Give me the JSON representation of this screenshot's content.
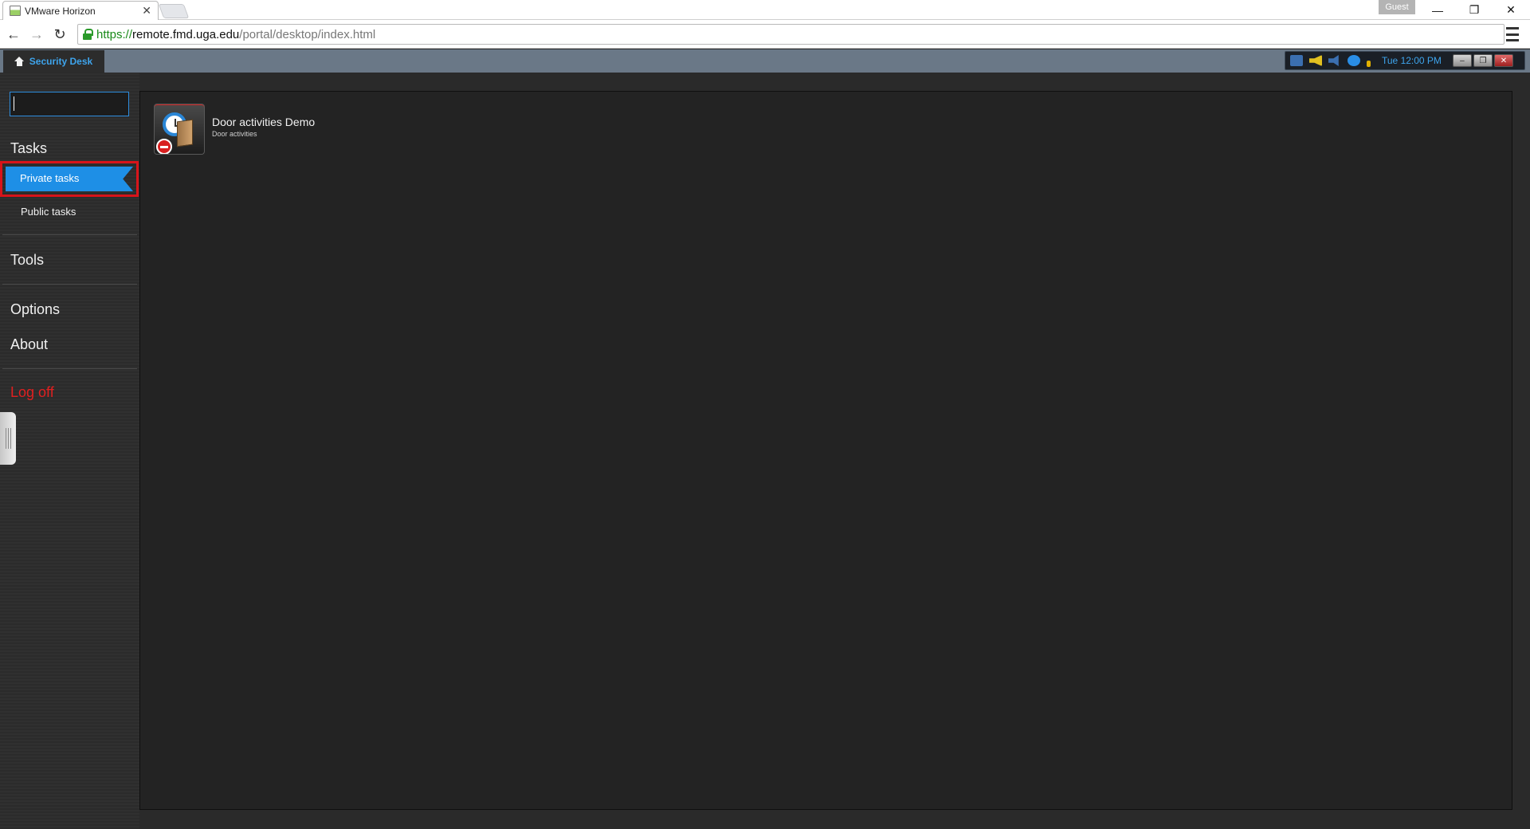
{
  "browser": {
    "tab_title": "VMware Horizon",
    "tab_close": "✕",
    "guest_label": "Guest",
    "minimize": "—",
    "restore": "❐",
    "close": "✕",
    "back": "←",
    "forward": "→",
    "reload": "↻",
    "url_scheme": "https://",
    "url_host": "remote.fmd.uga.edu",
    "url_path": "/portal/desktop/index.html"
  },
  "app_header": {
    "home_tab_label": "Security Desk",
    "tray_time": "Tue 12:00 PM",
    "tray_minimize": "–",
    "tray_restore": "❐",
    "tray_close": "✕"
  },
  "sidebar": {
    "search_value": "",
    "tasks_heading": "Tasks",
    "private_tasks": "Private tasks",
    "public_tasks": "Public tasks",
    "tools": "Tools",
    "options": "Options",
    "about": "About",
    "log_off": "Log off"
  },
  "main": {
    "tasks": [
      {
        "title": "Door activities Demo",
        "subtitle": "Door activities"
      }
    ]
  },
  "colors": {
    "accent_blue": "#1e8fe6",
    "highlight_red": "#d8141a",
    "logoff_red": "#e02020",
    "header_bar": "#6a7887"
  }
}
